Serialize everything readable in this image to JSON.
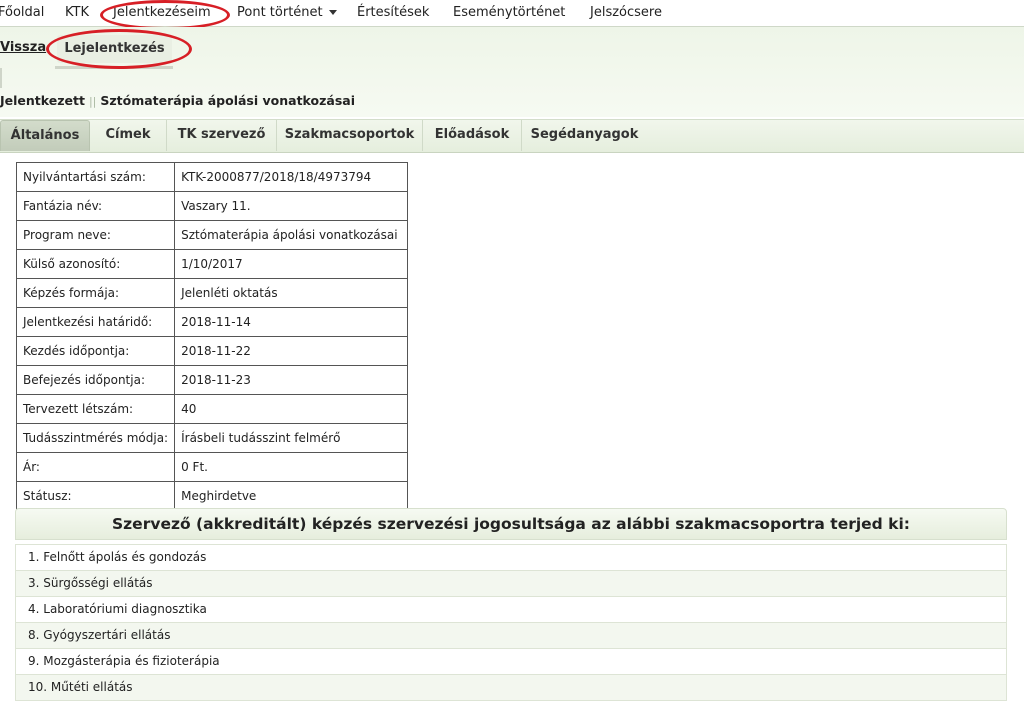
{
  "nav": {
    "items": [
      {
        "label": "Főoldal"
      },
      {
        "label": "KTK"
      },
      {
        "label": "Jelentkezéseim"
      },
      {
        "label": "Pont történet"
      },
      {
        "label": "Értesítések"
      },
      {
        "label": "Eseménytörténet"
      },
      {
        "label": "Jelszócsere"
      }
    ]
  },
  "actions": {
    "back": "Vissza",
    "signup": "Lejelentkezés"
  },
  "title": {
    "status": "Jelentkezett",
    "separator": "||",
    "name": "Sztómaterápia ápolási vonatkozásai"
  },
  "tabs": [
    {
      "label": "Általános"
    },
    {
      "label": "Címek"
    },
    {
      "label": "TK szervező"
    },
    {
      "label": "Szakmacsoportok"
    },
    {
      "label": "Előadások"
    },
    {
      "label": "Segédanyagok"
    }
  ],
  "details": [
    {
      "key": "Nyilvántartási szám:",
      "value": "KTK-2000877/2018/18/4973794"
    },
    {
      "key": "Fantázia név:",
      "value": "Vaszary 11."
    },
    {
      "key": "Program neve:",
      "value": "Sztómaterápia ápolási vonatkozásai"
    },
    {
      "key": "Külső azonosító:",
      "value": "1/10/2017"
    },
    {
      "key": "Képzés formája:",
      "value": "Jelenléti oktatás"
    },
    {
      "key": "Jelentkezési határidő:",
      "value": "2018-11-14"
    },
    {
      "key": "Kezdés időpontja:",
      "value": "2018-11-22"
    },
    {
      "key": "Befejezés időpontja:",
      "value": "2018-11-23"
    },
    {
      "key": "Tervezett létszám:",
      "value": "40"
    },
    {
      "key": "Tudásszintmérés módja:",
      "value": "Írásbeli tudásszint felmérő"
    },
    {
      "key": "Ár:",
      "value": "0 Ft."
    },
    {
      "key": "Státusz:",
      "value": "Meghirdetve"
    }
  ],
  "section": {
    "heading": "Szervező (akkreditált) képzés szervezési jogosultsága az alábbi szakmacsoportra terjed ki:",
    "groups": [
      "1. Felnőtt ápolás és gondozás",
      "3. Sürgősségi ellátás",
      "4. Laboratóriumi diagnosztika",
      "8. Gyógyszertári ellátás",
      "9. Mozgásterápia és fizioterápia",
      "10. Műtéti ellátás"
    ]
  },
  "colors": {
    "highlight_oval": "#d71f26",
    "accent_green": "#e6eedd"
  },
  "icons": {
    "dropdown": "chevron-down-icon"
  }
}
